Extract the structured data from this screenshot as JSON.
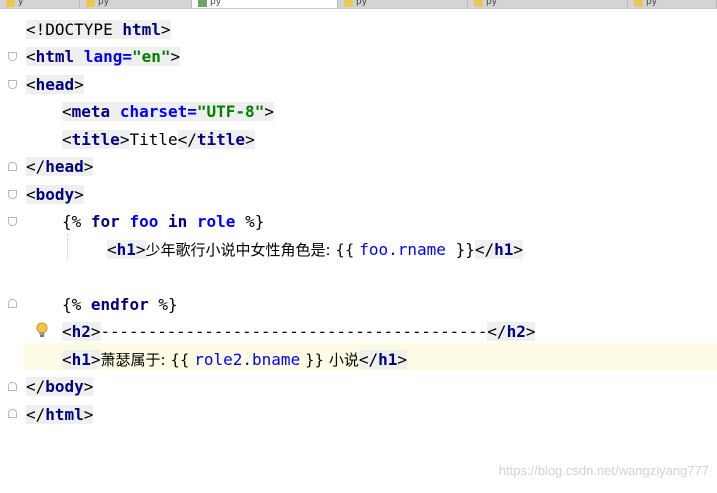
{
  "editor": {
    "tabs": [
      {
        "label": "y"
      },
      {
        "label": "py"
      },
      {
        "label": "py"
      },
      {
        "label": "py"
      },
      {
        "label": "py"
      },
      {
        "label": "py"
      }
    ],
    "lines": {
      "l1_doctype": "<!DOCTYPE ",
      "l1_html": "html",
      "l1_end": ">",
      "l2_open": "<",
      "l2_tag": "html",
      "l2_attr": "lang",
      "l2_eq": "=",
      "l2_val": "\"en\"",
      "l2_close": ">",
      "l3_open": "<",
      "l3_tag": "head",
      "l3_close": ">",
      "l4_open": "<",
      "l4_tag": "meta",
      "l4_attr": "charset",
      "l4_eq": "=",
      "l4_val": "\"UTF-8\"",
      "l4_close": ">",
      "l5_o1": "<",
      "l5_t1": "title",
      "l5_c1": ">",
      "l5_text": "Title",
      "l5_o2": "</",
      "l5_t2": "title",
      "l5_c2": ">",
      "l6_open": "</",
      "l6_tag": "head",
      "l6_close": ">",
      "l7_open": "<",
      "l7_tag": "body",
      "l7_close": ">",
      "l8_open": "{% ",
      "l8_for": "for",
      "l8_foo": "foo",
      "l8_in": "in",
      "l8_role": "role",
      "l8_close": " %}",
      "l9_o1": "<",
      "l9_t1": "h1",
      "l9_c1": ">",
      "l9_text": "少年歌行小说中女性角色是: {{ ",
      "l9_var": "foo.rname",
      "l9_after": " }}",
      "l9_o2": "</",
      "l9_t2": "h1",
      "l9_c2": ">",
      "l11_open": "{% ",
      "l11_kw": "endfor",
      "l11_close": " %}",
      "l12_o1": "<",
      "l12_t1": "h2",
      "l12_c1": ">",
      "l12_text": "-----------------------------------------",
      "l12_o2": "</",
      "l12_t2": "h2",
      "l12_c2": ">",
      "l13_o1": "<",
      "l13_t1": "h1",
      "l13_c1": ">",
      "l13_text": "萧瑟属于: {{ ",
      "l13_var": "role2.bname",
      "l13_after": " }} 小说",
      "l13_o2": "</",
      "l13_t2": "h1",
      "l13_c2": ">",
      "l14_open": "</",
      "l14_tag": "body",
      "l14_close": ">",
      "l15_open": "</",
      "l15_tag": "html",
      "l15_close": ">"
    }
  },
  "watermark": "https://blog.csdn.net/wangziyang777",
  "colors": {
    "tag": "#000080",
    "attribute": "#0000ff",
    "string": "#008000",
    "current_line": "#fdfbe3",
    "tag_background": "#efefef"
  },
  "icons": {
    "fold": "fold-marker-icon",
    "intention": "lightbulb-icon"
  }
}
